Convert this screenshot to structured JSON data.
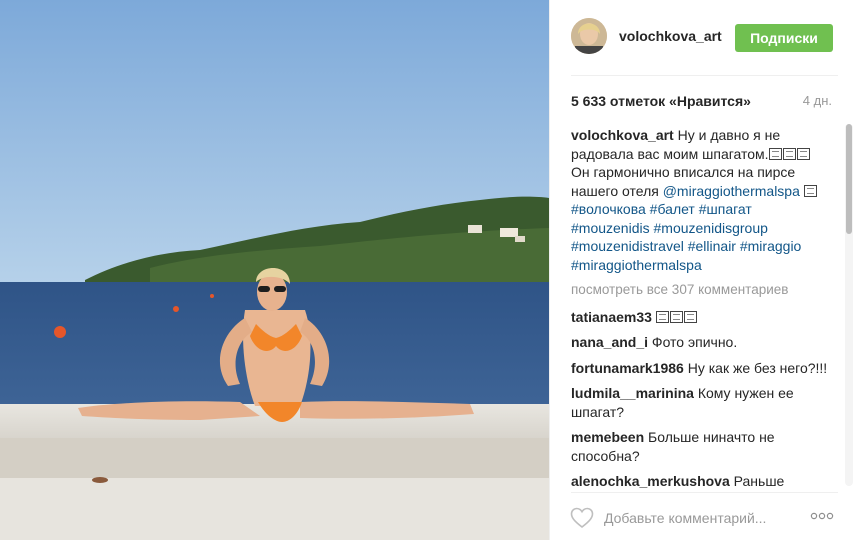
{
  "post": {
    "username": "volochkova_art",
    "follow_label": "Подписки",
    "likes": "5 633 отметок «Нравится»",
    "age": "4 дн."
  },
  "caption": {
    "username": "volochkova_art",
    "text1": "Ну и давно я не радовала вас моим шпагатом.",
    "text2": "Он гармонично вписался на пирсе нашего отеля",
    "mention": "@miraggiothermalspa",
    "tags1": "#волочкова #балет #шпагат",
    "tags2": "#mouzenidis #mouzenidisgroup",
    "tags3": "#mouzenidistravel #ellinair #miraggio",
    "tags4": "#miraggiothermalspa"
  },
  "view_all": "посмотреть все 307 комментариев",
  "comments": [
    {
      "user": "tatianaem33",
      "text": ""
    },
    {
      "user": "nana_and_i",
      "text": "Фото эпично."
    },
    {
      "user": "fortunamark1986",
      "text": "Ну как же без него?!!!"
    },
    {
      "user": "ludmila__marinina",
      "text": "Кому нужен ее шпагат?"
    },
    {
      "user": "memebeen",
      "text": "Больше ниначто не способна?"
    },
    {
      "user": "alenochka_merkushova",
      "text": "Раньше никогда не замечала, пока не зашла сюда, у неё некрасивая фигура"
    }
  ],
  "footer": {
    "placeholder": "Добавьте комментарий...",
    "icons": {
      "like": "heart-icon",
      "options": "more-options-icon"
    }
  },
  "colors": {
    "follow": "#70c050",
    "link": "#125688",
    "muted": "#999999"
  }
}
